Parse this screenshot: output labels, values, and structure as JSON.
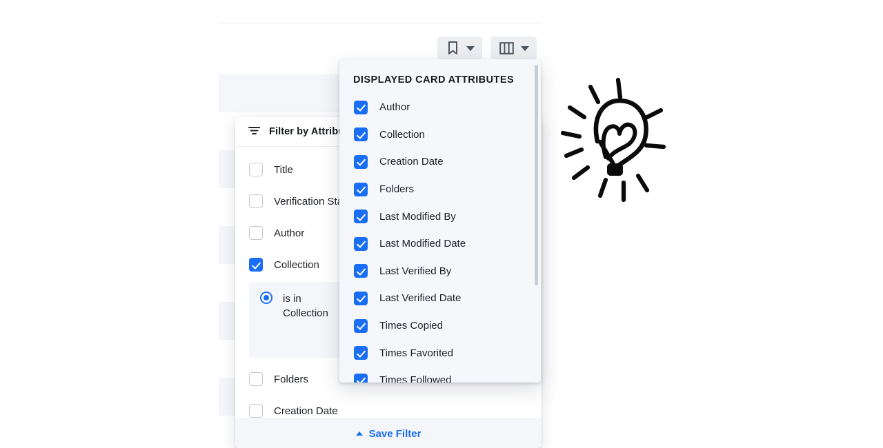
{
  "toolbar": {
    "bookmark_button": {
      "icon": "bookmark-icon",
      "caret": "chevron-down-icon"
    },
    "columns_button": {
      "icon": "columns-icon",
      "caret": "chevron-down-icon"
    }
  },
  "filter_panel": {
    "title": "Filter by Attribute",
    "icon": "filter-icon",
    "rows": [
      {
        "label": "Title",
        "checked": false
      },
      {
        "label": "Verification Status",
        "checked": false
      },
      {
        "label": "Author",
        "checked": false
      },
      {
        "label": "Collection",
        "checked": true
      }
    ],
    "collection_condition": {
      "radio_label": "is in Collection",
      "selected": true,
      "input_value": ""
    },
    "rows_after": [
      {
        "label": "Folders",
        "checked": false
      },
      {
        "label": "Creation Date",
        "checked": false
      }
    ],
    "footer": {
      "label": "Save Filter",
      "icon": "chevron-up-icon"
    }
  },
  "attributes_menu": {
    "title": "DISPLAYED CARD ATTRIBUTES",
    "items": [
      {
        "label": "Author",
        "checked": true
      },
      {
        "label": "Collection",
        "checked": true
      },
      {
        "label": "Creation Date",
        "checked": true
      },
      {
        "label": "Folders",
        "checked": true
      },
      {
        "label": "Last Modified By",
        "checked": true
      },
      {
        "label": "Last Modified Date",
        "checked": true
      },
      {
        "label": "Last Verified By",
        "checked": true
      },
      {
        "label": "Last Verified Date",
        "checked": true
      },
      {
        "label": "Times Copied",
        "checked": true
      },
      {
        "label": "Times Favorited",
        "checked": true
      },
      {
        "label": "Times Followed",
        "checked": true
      }
    ],
    "scrollbar": {
      "name": "vertical-scrollbar"
    }
  },
  "illustration": {
    "name": "lightbulb-with-heart-doodle"
  },
  "colors": {
    "accent_blue": "#1a6ef5",
    "panel_gray": "#f5f7fa",
    "row_stripe": "#f4f6f9",
    "text": "#1c1f24"
  }
}
